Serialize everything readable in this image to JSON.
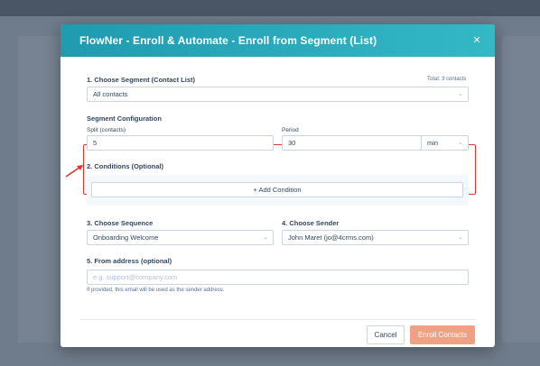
{
  "modal": {
    "title": "FlowNer - Enroll & Automate - Enroll from Segment (List)",
    "close_icon": "×"
  },
  "segment": {
    "label": "1. Choose Segment (Contact List)",
    "total": "Total: 3 contacts",
    "selected": "All contacts"
  },
  "config": {
    "title": "Segment Configuration",
    "split_label": "Split (contacts)",
    "split_value": "5",
    "period_label": "Period",
    "period_value": "30",
    "unit_value": "min"
  },
  "conditions": {
    "label": "2. Conditions (Optional)",
    "add_button": "+ Add Condition"
  },
  "sequence": {
    "label": "3. Choose Sequence",
    "selected": "Onboarding Welcome"
  },
  "sender": {
    "label": "4. Choose Sender",
    "selected": "John Maret (jo@4crms.com)"
  },
  "from_address": {
    "label": "5. From address (optional)",
    "placeholder": "e.g. support@company.com",
    "help": "If provided, this email will be used as the sender address."
  },
  "footer": {
    "cancel": "Cancel",
    "enroll": "Enroll Contacts"
  },
  "colors": {
    "header_start": "#1f9bb0",
    "header_end": "#33b8c6",
    "highlight": "#e0332e",
    "primary_button": "#f0a184"
  }
}
